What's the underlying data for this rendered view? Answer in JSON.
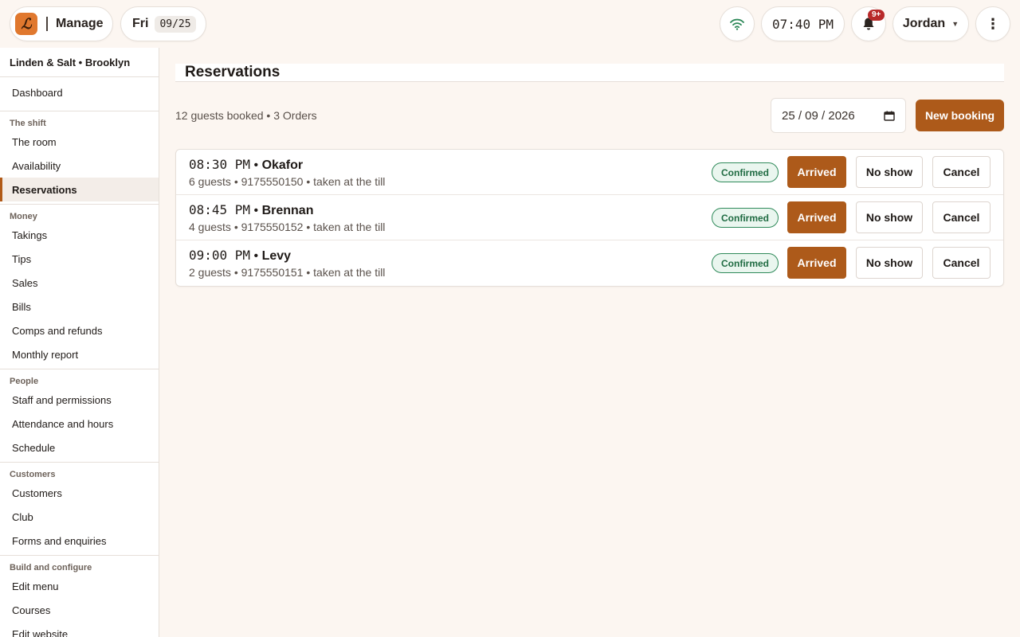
{
  "topbar": {
    "logo_glyph": "ℒ",
    "mode_label": "Manage",
    "day": "Fri",
    "date": "09/25",
    "clock": "07:40 PM",
    "notifications_badge": "9+",
    "user_name": "Jordan",
    "more_glyph": "⋮"
  },
  "sidebar": {
    "venue": "Linden & Salt • Brooklyn",
    "dashboard": "Dashboard",
    "groups": [
      {
        "heading": "The shift",
        "items": [
          "The room",
          "Availability",
          "Reservations"
        ]
      },
      {
        "heading": "Money",
        "items": [
          "Takings",
          "Tips",
          "Sales",
          "Bills",
          "Comps and refunds",
          "Monthly report"
        ]
      },
      {
        "heading": "People",
        "items": [
          "Staff and permissions",
          "Attendance and hours",
          "Schedule"
        ]
      },
      {
        "heading": "Customers",
        "items": [
          "Customers",
          "Club",
          "Forms and enquiries"
        ]
      },
      {
        "heading": "Build and configure",
        "items": [
          "Edit menu",
          "Courses",
          "Edit website"
        ]
      }
    ],
    "active_item": "Reservations"
  },
  "main": {
    "title": "Reservations",
    "summary": "12 guests booked • 3 Orders",
    "date_value": "25 / 09 / 2026",
    "new_booking_label": "New booking",
    "reservations": [
      {
        "time": "08:30 PM",
        "name": "Okafor",
        "details": "6 guests • 9175550150 • taken at the till",
        "status": "Confirmed"
      },
      {
        "time": "08:45 PM",
        "name": "Brennan",
        "details": "4 guests • 9175550152 • taken at the till",
        "status": "Confirmed"
      },
      {
        "time": "09:00 PM",
        "name": "Levy",
        "details": "2 guests • 9175550151 • taken at the till",
        "status": "Confirmed"
      }
    ],
    "actions": {
      "arrived": "Arrived",
      "no_show": "No show",
      "cancel": "Cancel"
    },
    "separator": " • "
  },
  "colors": {
    "accent": "#ad5a1a",
    "logo": "#e0782e",
    "badge": "#b8292a",
    "status_green": "#2f8a5a",
    "wifi": "#2f8a5a",
    "background": "#fcf6f1"
  }
}
